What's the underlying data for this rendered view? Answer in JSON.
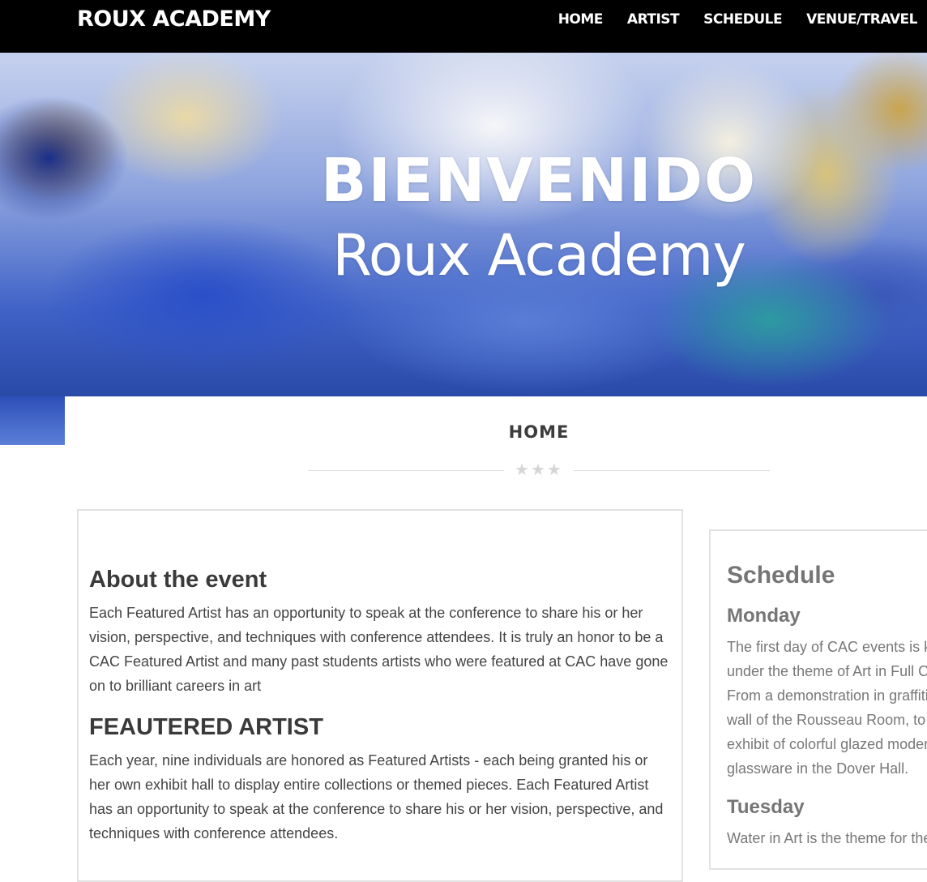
{
  "brand": "ROUX ACADEMY",
  "nav": [
    "HOME",
    "ARTIST",
    "SCHEDULE",
    "VENUE/TRAVEL"
  ],
  "hero": {
    "title": "BIENVENIDO",
    "subtitle": "Roux Academy"
  },
  "page": {
    "title": "HOME"
  },
  "about": {
    "heading": "About the event",
    "text": "Each Featured Artist has an opportunity to speak at the conference to share his or her vision, perspective, and techniques with conference attendees. It is truly an honor to be a CAC Featured Artist and many past students artists who were featured at CAC have gone on to brilliant careers in art"
  },
  "featured": {
    "heading": "FEAUTERED ARTIST",
    "text": "Each year, nine individuals are honored as Featured Artists - each being granted his or her own exhibit hall to display entire collections or themed pieces. Each Featured Artist has an opportunity to speak at the conference to share his or her vision, perspective, and techniques with conference attendees."
  },
  "schedule": {
    "heading": "Schedule",
    "monday": {
      "day": "Monday",
      "lines": [
        "The first day of CAC events is ki",
        "under the theme of Art in Full Co",
        "From a demonstration in graffiti",
        "wall of the Rousseau Room, to t",
        "exhibit of colorful glazed moder",
        "glassware in the Dover Hall."
      ]
    },
    "tuesday": {
      "day": "Tuesday",
      "line": "Water in Art is the theme for the"
    }
  },
  "colors": {
    "nav_bg": "#000000",
    "heading_text": "#3a3a3a",
    "sidebar_text": "#757575"
  }
}
